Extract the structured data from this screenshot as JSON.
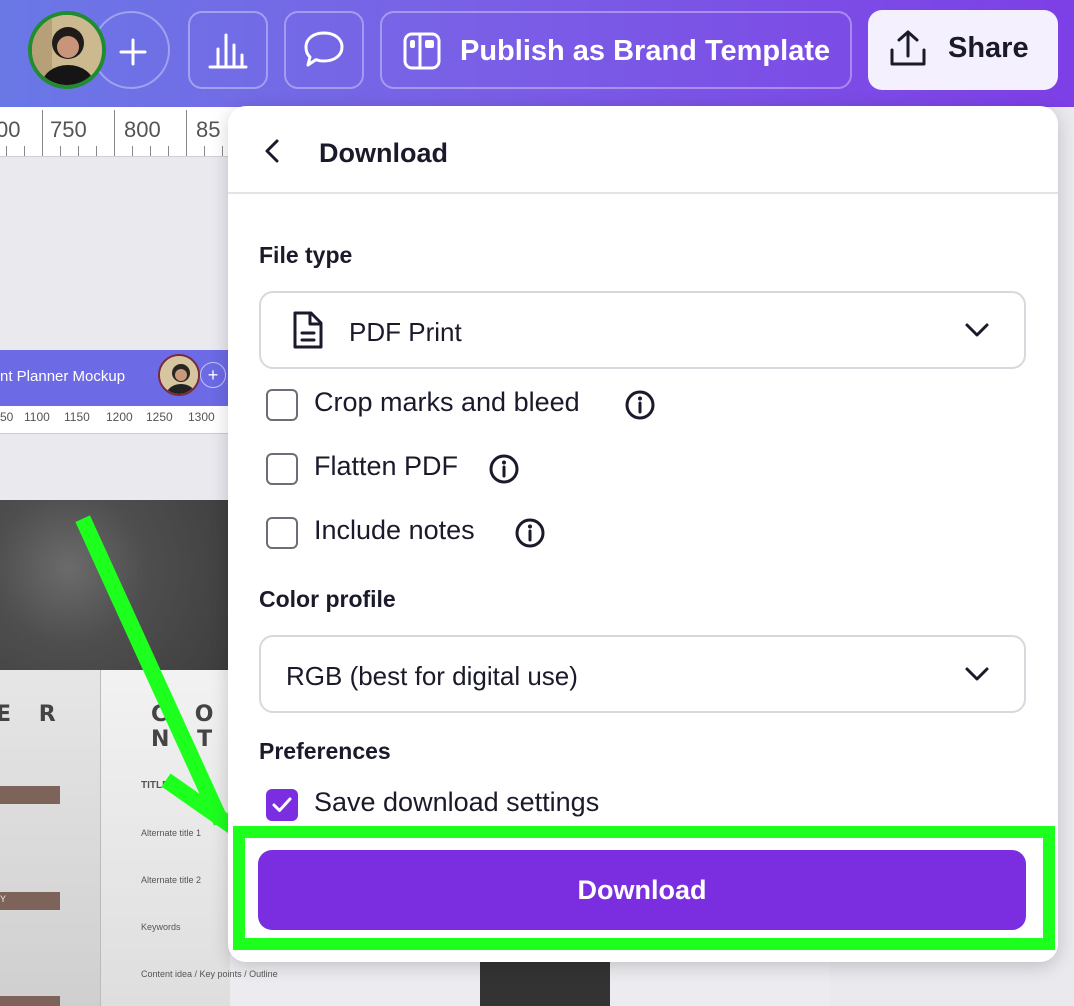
{
  "topbar": {
    "publish_label": "Publish as Brand Template",
    "share_label": "Share",
    "accent": "#7d3fe6"
  },
  "ruler": {
    "ticks": [
      "00",
      "750",
      "800",
      "85"
    ]
  },
  "inner_editor": {
    "title": "nt Planner Mockup",
    "plus": "+",
    "ruler_ticks": [
      "50",
      "1100",
      "1150",
      "1200",
      "1250",
      "1300"
    ]
  },
  "mockup": {
    "heading_left": "E R",
    "heading_right": "C O N T",
    "field_title": "TITLE",
    "field_alt1": "Alternate title 1",
    "field_alt2": "Alternate title 2",
    "field_keywords": "Keywords",
    "field_content": "Content idea / Key points / Outline",
    "small_y": "Y"
  },
  "panel": {
    "title": "Download",
    "file_type_label": "File type",
    "file_type_value": "PDF Print",
    "options": [
      {
        "label": "Crop marks and bleed",
        "checked": false
      },
      {
        "label": "Flatten PDF",
        "checked": false
      },
      {
        "label": "Include notes",
        "checked": false
      }
    ],
    "color_profile_label": "Color profile",
    "color_profile_value": "RGB (best for digital use)",
    "preferences_label": "Preferences",
    "save_settings_label": "Save download settings",
    "save_settings_checked": true,
    "download_button": "Download",
    "primary_color": "#7b2ee0",
    "highlight_color": "#1dff1d"
  }
}
